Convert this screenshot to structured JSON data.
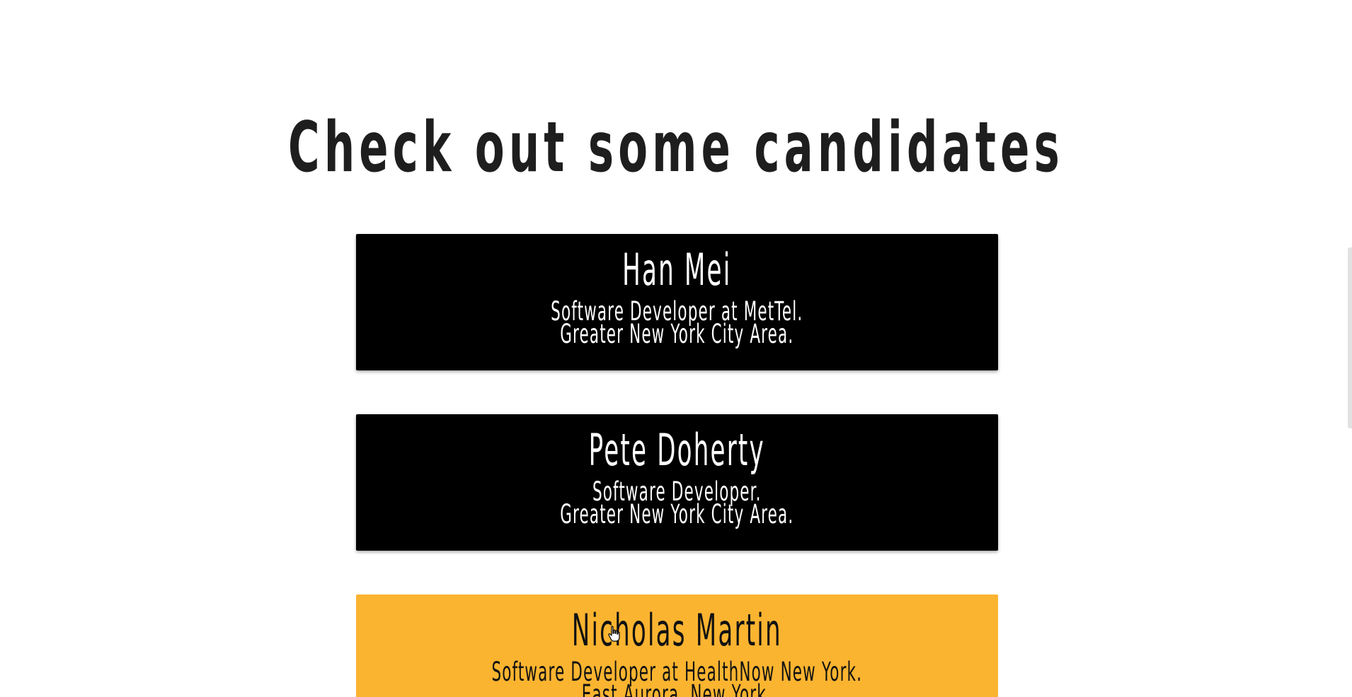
{
  "page": {
    "title": "Check out some candidates"
  },
  "candidates": [
    {
      "name": "Han Mei",
      "role": "Software Developer at MetTel.",
      "location": "Greater New York City Area."
    },
    {
      "name": "Pete Doherty",
      "role": "Software Developer.",
      "location": "Greater New York City Area."
    },
    {
      "name": "Nicholas Martin",
      "role": "Software Developer at HealthNow New York.",
      "location": "East Aurora, New York."
    }
  ],
  "colors": {
    "card_background": "#000000",
    "card_highlight": "#fbb430",
    "title_text": "#1e1e1e"
  },
  "cursor": {
    "icon": "hand-pointer-icon"
  }
}
